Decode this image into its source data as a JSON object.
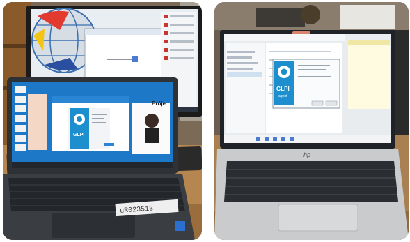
{
  "left_photo": {
    "laptop_sticker": "uR023513",
    "logo_letters": "GLPI",
    "logo_sub": "agent",
    "monitor_label": "Eróje"
  },
  "right_photo": {
    "logo_letters": "GLPI",
    "logo_sub": "agent",
    "brand": "hp"
  },
  "colors": {
    "desk_wood": "#b5864f",
    "screen_blue": "#1e78c8",
    "glpi_blue": "#1d8fcf",
    "laptop_dark": "#2e3236",
    "laptop_silver": "#cfd1d3"
  }
}
